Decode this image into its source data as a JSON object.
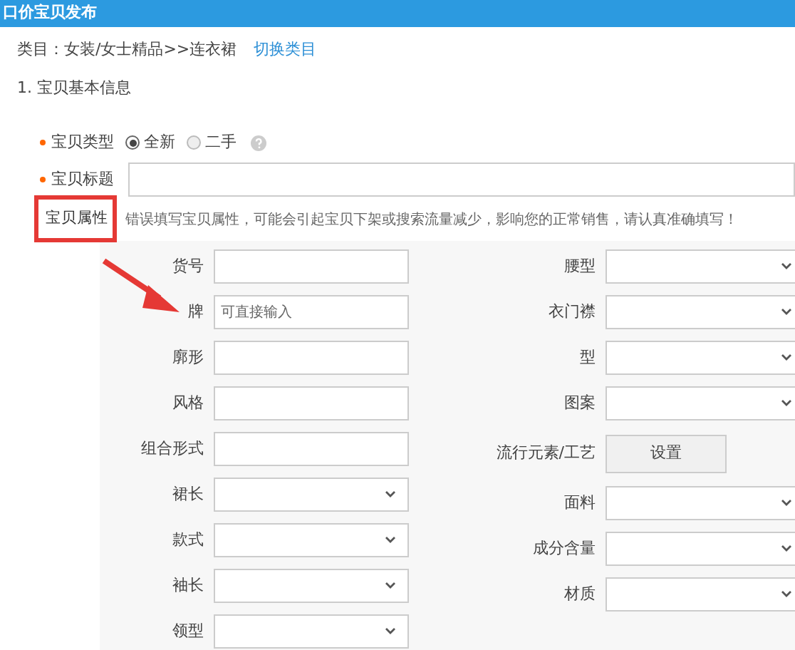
{
  "window": {
    "title": "口价宝贝发布"
  },
  "category": {
    "label": "类目：女装/女士精品>>连衣裙",
    "link": "切换类目"
  },
  "section": "1. 宝贝基本信息",
  "item_type": {
    "label": "宝贝类型",
    "required": true,
    "options": [
      {
        "label": "全新",
        "selected": true
      },
      {
        "label": "二手",
        "selected": false
      }
    ]
  },
  "item_title": {
    "label": "宝贝标题",
    "required": true
  },
  "attributes": {
    "label": "宝贝属性",
    "warning": "错误填写宝贝属性，可能会引起宝贝下架或搜索流量减少，影响您的正常销售，请认真准确填写！",
    "left": [
      {
        "kind": "input",
        "label": "货号"
      },
      {
        "kind": "input",
        "label": "牌",
        "placeholder": "可直接输入"
      },
      {
        "kind": "input",
        "label": "廓形"
      },
      {
        "kind": "input",
        "label": "风格"
      },
      {
        "kind": "input",
        "label": "组合形式"
      },
      {
        "kind": "select",
        "label": "裙长"
      },
      {
        "kind": "select",
        "label": "款式"
      },
      {
        "kind": "select",
        "label": "袖长"
      },
      {
        "kind": "select",
        "label": "领型"
      }
    ],
    "right": [
      {
        "kind": "select",
        "label": "腰型"
      },
      {
        "kind": "select",
        "label": "衣门襟"
      },
      {
        "kind": "select",
        "label": "型"
      },
      {
        "kind": "select",
        "label": "图案"
      },
      {
        "kind": "button",
        "label": "流行元素/工艺",
        "button": "设置"
      },
      {
        "kind": "select",
        "label": "面料"
      },
      {
        "kind": "select",
        "label": "成分含量"
      },
      {
        "kind": "select",
        "label": "材质"
      }
    ]
  }
}
